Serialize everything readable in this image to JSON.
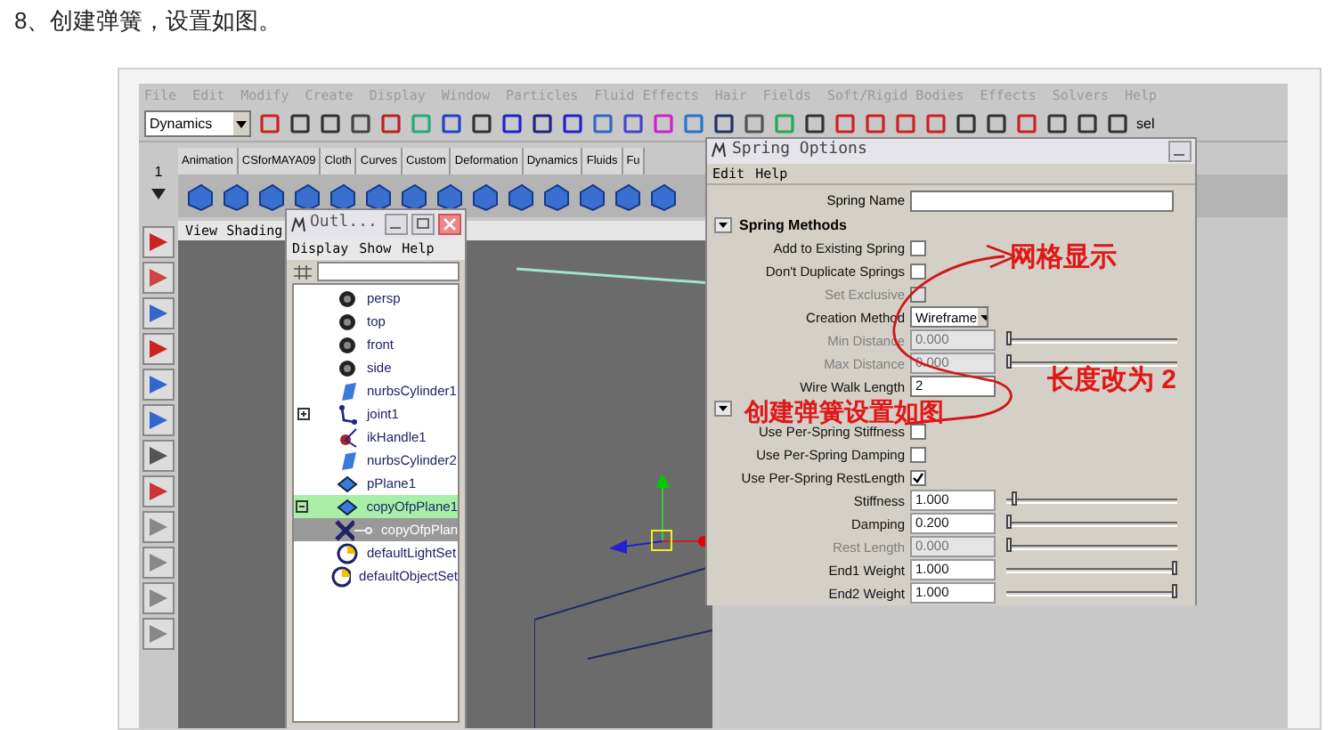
{
  "caption": "8、创建弹簧，设置如图。",
  "menubar": [
    "File",
    "Edit",
    "Modify",
    "Create",
    "Display",
    "Window",
    "Particles",
    "Fluid Effects",
    "Hair",
    "Fields",
    "Soft/Rigid Bodies",
    "Effects",
    "Solvers",
    "Help"
  ],
  "menu_set": "Dynamics",
  "toolbar_label": "sel",
  "shelf_index": "1",
  "shelf_tabs": [
    "Animation",
    "CSforMAYA09",
    "Cloth",
    "Curves",
    "Custom",
    "Deformation",
    "Dynamics",
    "Fluids",
    "Fu"
  ],
  "viewport": {
    "menu": [
      "View",
      "Shading"
    ]
  },
  "outliner": {
    "title": "Outl...",
    "menu": [
      "Display",
      "Show",
      "Help"
    ],
    "items": [
      {
        "label": "persp",
        "kind": "camera",
        "highlighted": false,
        "selected": false
      },
      {
        "label": "top",
        "kind": "camera",
        "highlighted": false,
        "selected": false
      },
      {
        "label": "front",
        "kind": "camera",
        "highlighted": false,
        "selected": false
      },
      {
        "label": "side",
        "kind": "camera",
        "highlighted": false,
        "selected": false
      },
      {
        "label": "nurbsCylinder1",
        "kind": "nurbs",
        "highlighted": false,
        "selected": false
      },
      {
        "label": "joint1",
        "kind": "joint",
        "highlighted": false,
        "selected": false,
        "expanded": false
      },
      {
        "label": "ikHandle1",
        "kind": "ik",
        "highlighted": false,
        "selected": false
      },
      {
        "label": "nurbsCylinder2",
        "kind": "nurbs",
        "highlighted": false,
        "selected": false
      },
      {
        "label": "pPlane1",
        "kind": "mesh",
        "highlighted": false,
        "selected": false
      },
      {
        "label": "copyOfpPlane1",
        "kind": "mesh",
        "highlighted": true,
        "selected": false,
        "expanded": true,
        "children": [
          {
            "label": "copyOfpPlan",
            "kind": "spring",
            "highlighted": false,
            "selected": true
          }
        ]
      },
      {
        "label": "defaultLightSet",
        "kind": "set",
        "highlighted": false,
        "selected": false
      },
      {
        "label": "defaultObjectSet",
        "kind": "set",
        "highlighted": false,
        "selected": false
      }
    ]
  },
  "spring_options": {
    "title": "Spring Options",
    "menu": [
      "Edit",
      "Help"
    ],
    "spring_name": {
      "label": "Spring Name"
    },
    "sections": [
      {
        "title": "Spring Methods",
        "expanded": true,
        "rows": [
          {
            "kind": "checkbox",
            "label": "Add to Existing Spring",
            "checked": false,
            "disabled": false
          },
          {
            "kind": "checkbox",
            "label": "Don't Duplicate Springs",
            "checked": false,
            "disabled": false
          },
          {
            "kind": "checkbox",
            "label": "Set Exclusive",
            "checked": false,
            "disabled": true
          },
          {
            "kind": "dropdown",
            "label": "Creation Method",
            "value": "Wireframe",
            "disabled": false
          },
          {
            "kind": "slider",
            "label": "Min Distance",
            "value": "0.000",
            "level": 0,
            "disabled": true
          },
          {
            "kind": "slider",
            "label": "Max Distance",
            "value": "0.000",
            "level": 0,
            "disabled": true
          },
          {
            "kind": "field",
            "label": "Wire Walk Length",
            "value": "2",
            "disabled": false
          }
        ]
      },
      {
        "expanded": true,
        "rows": [
          {
            "kind": "checkbox",
            "label": "Use Per-Spring Stiffness",
            "checked": false,
            "disabled": false
          },
          {
            "kind": "checkbox",
            "label": "Use Per-Spring Damping",
            "checked": false,
            "disabled": false
          },
          {
            "kind": "checkbox",
            "label": "Use Per-Spring RestLength",
            "checked": true,
            "disabled": false
          },
          {
            "kind": "slider",
            "label": "Stiffness",
            "value": "1.000",
            "level": 0.03,
            "disabled": false
          },
          {
            "kind": "slider",
            "label": "Damping",
            "value": "0.200",
            "level": 0.005,
            "disabled": false
          },
          {
            "kind": "slider",
            "label": "Rest Length",
            "value": "0.000",
            "level": 0,
            "disabled": true
          },
          {
            "kind": "slider",
            "label": "End1 Weight",
            "value": "1.000",
            "level": 1,
            "disabled": false
          },
          {
            "kind": "slider",
            "label": "End2 Weight",
            "value": "1.000",
            "level": 1,
            "disabled": false
          }
        ]
      }
    ]
  },
  "annotations": [
    "网格显示",
    "长度改为 2",
    "创建弹簧设置如图"
  ]
}
